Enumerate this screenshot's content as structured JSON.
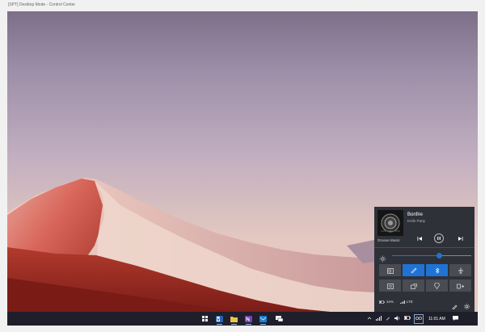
{
  "window": {
    "title": "[SPT] Desktop Mode - Control Center"
  },
  "media": {
    "track": "Bonfire",
    "artist": "Knife Party",
    "app": "Groove Music",
    "brightness_level": 0.6
  },
  "quick_actions": [
    {
      "icon": "tablet-mode-icon",
      "on": false
    },
    {
      "icon": "focus-assist-icon",
      "on": true
    },
    {
      "icon": "bluetooth-icon",
      "on": true
    },
    {
      "icon": "airplane-mode-icon",
      "on": false
    },
    {
      "icon": "screenshot-icon",
      "on": false
    },
    {
      "icon": "project-icon",
      "on": false
    },
    {
      "icon": "location-icon",
      "on": false
    },
    {
      "icon": "connect-icon",
      "on": false
    }
  ],
  "status_bar": {
    "battery": "34%",
    "network": "LTE"
  },
  "taskbar": {
    "apps": [
      "windows-start-icon",
      "word-icon",
      "file-explorer-icon",
      "onenote-icon",
      "mail-icon",
      "chat-icon"
    ],
    "time": "11:01 AM"
  },
  "colors": {
    "accent": "#1f73d4",
    "panel": "#2f3139",
    "taskbar": "#1e1f2a"
  }
}
